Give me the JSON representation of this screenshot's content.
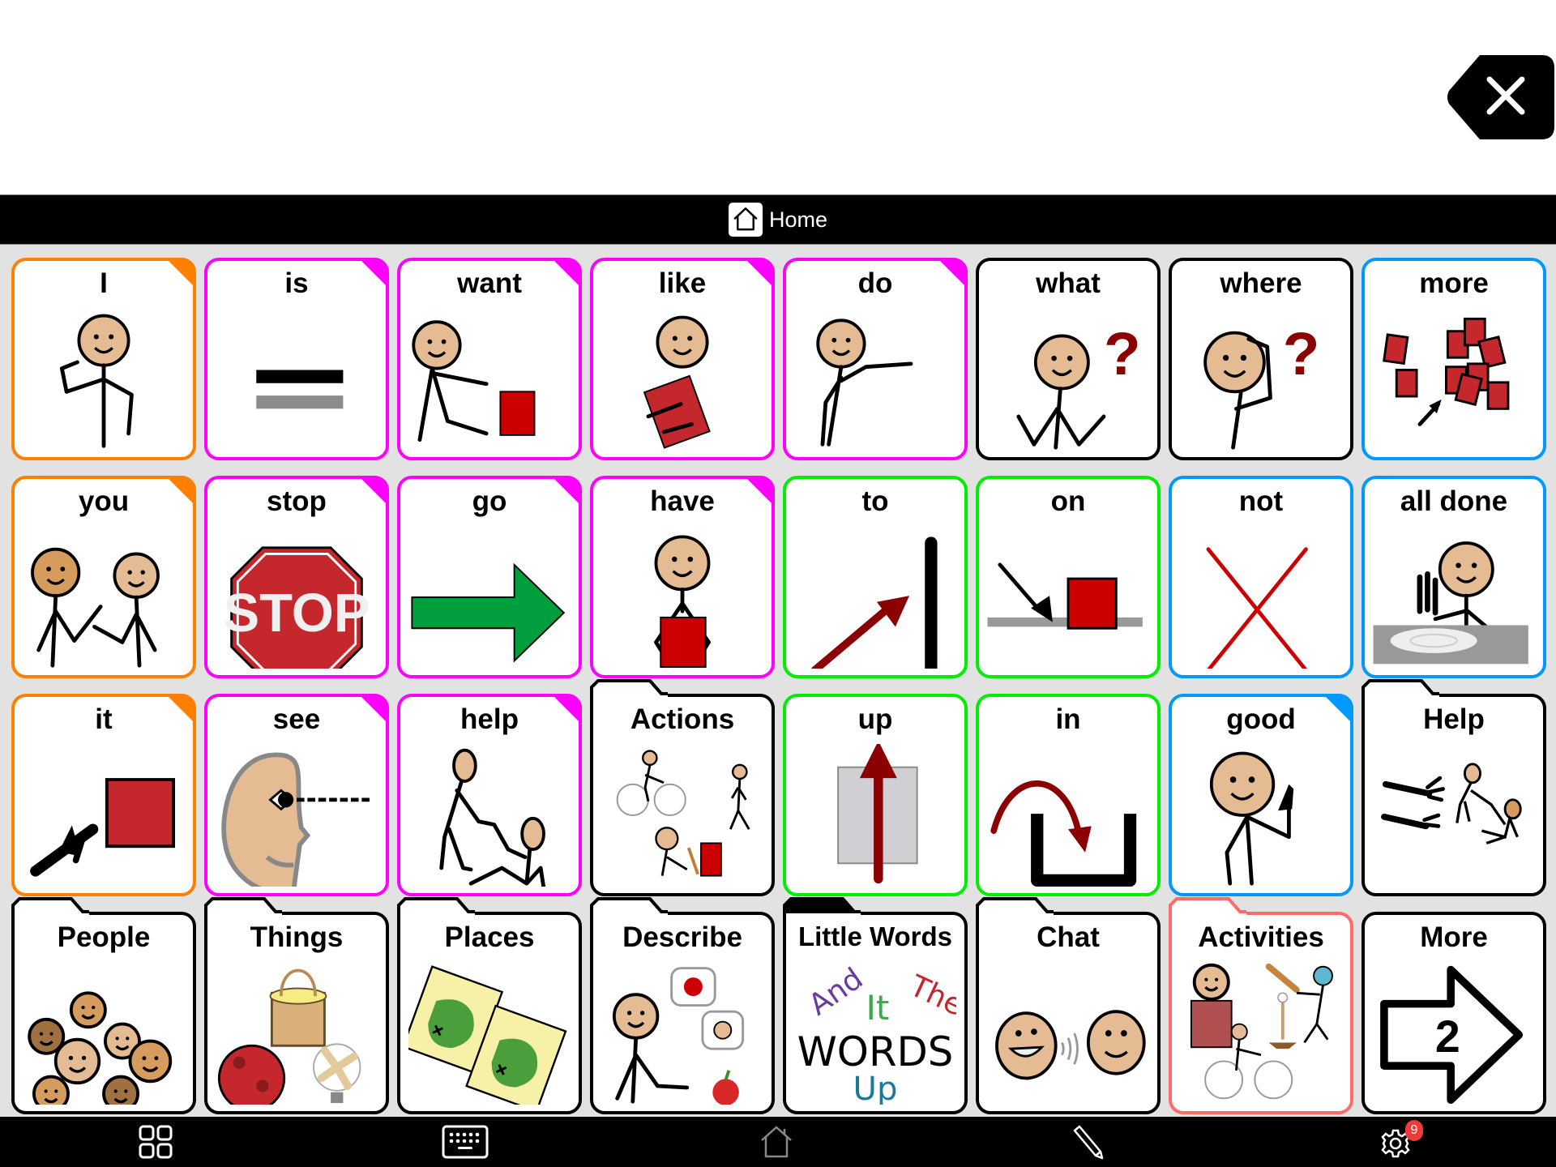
{
  "message_bar": {
    "text": "",
    "clear_button": "clear-message"
  },
  "navbar": {
    "title": "Home",
    "icon": "home-icon"
  },
  "colors": {
    "pronoun": "#ff8000",
    "verb": "#ff00ff",
    "preposition": "#00ee00",
    "adjective": "#0099ff",
    "folder": "#000000",
    "activities_folder": "#ff6b6b",
    "grid_bg": "#e2e2e2"
  },
  "cells": [
    {
      "label": "I",
      "type": "pronoun",
      "icon": "person-pointing-self"
    },
    {
      "label": "is",
      "type": "verb",
      "icon": "equals-sign"
    },
    {
      "label": "want",
      "type": "verb",
      "icon": "person-reaching-box"
    },
    {
      "label": "like",
      "type": "verb",
      "icon": "person-hugging-box"
    },
    {
      "label": "do",
      "type": "verb",
      "icon": "person-reaching"
    },
    {
      "label": "what",
      "type": "question",
      "icon": "person-shrugging-question"
    },
    {
      "label": "where",
      "type": "question",
      "icon": "person-searching-question"
    },
    {
      "label": "more",
      "type": "adjective",
      "icon": "many-red-boxes"
    },
    {
      "label": "you",
      "type": "pronoun",
      "icon": "people-pointing"
    },
    {
      "label": "stop",
      "type": "verb",
      "icon": "stop-sign"
    },
    {
      "label": "go",
      "type": "verb",
      "icon": "green-arrow-right"
    },
    {
      "label": "have",
      "type": "verb",
      "icon": "person-holding-box"
    },
    {
      "label": "to",
      "type": "preposition",
      "icon": "arrow-to-line"
    },
    {
      "label": "on",
      "type": "preposition",
      "icon": "arrow-onto-surface"
    },
    {
      "label": "not",
      "type": "adjective",
      "icon": "red-x"
    },
    {
      "label": "all done",
      "type": "adjective",
      "icon": "person-finished-plate"
    },
    {
      "label": "it",
      "type": "pronoun",
      "icon": "hand-pointing-box"
    },
    {
      "label": "see",
      "type": "verb",
      "icon": "face-eye-looking"
    },
    {
      "label": "help",
      "type": "verb",
      "icon": "person-helping-person"
    },
    {
      "label": "Actions",
      "type": "folder",
      "icon": "actions-collage"
    },
    {
      "label": "up",
      "type": "preposition",
      "icon": "arrow-up"
    },
    {
      "label": "in",
      "type": "preposition",
      "icon": "arrow-into-container"
    },
    {
      "label": "good",
      "type": "adjective",
      "icon": "person-thumbs-up"
    },
    {
      "label": "Help",
      "type": "folder",
      "icon": "help-hands"
    },
    {
      "label": "People",
      "type": "folder",
      "icon": "group-of-faces"
    },
    {
      "label": "Things",
      "type": "folder",
      "icon": "basket-ball-fan"
    },
    {
      "label": "Places",
      "type": "folder",
      "icon": "treasure-maps"
    },
    {
      "label": "Describe",
      "type": "folder",
      "icon": "person-describing"
    },
    {
      "label": "Little Words",
      "type": "folder_dark",
      "icon": "little-words",
      "words": [
        "And",
        "It",
        "The",
        "WORDS",
        "Up"
      ]
    },
    {
      "label": "Chat",
      "type": "folder",
      "icon": "two-faces-talking"
    },
    {
      "label": "Activities",
      "type": "folder_activities",
      "icon": "activities-collage"
    },
    {
      "label": "More",
      "type": "navigate",
      "icon": "arrow-page",
      "page_number": "2"
    }
  ],
  "toolbar": {
    "items": [
      {
        "name": "apps-grid",
        "icon": "grid-icon"
      },
      {
        "name": "keyboard",
        "icon": "keyboard-icon"
      },
      {
        "name": "home",
        "icon": "home-icon"
      },
      {
        "name": "edit",
        "icon": "pencil-icon"
      },
      {
        "name": "settings",
        "icon": "gear-icon",
        "badge": "9"
      }
    ]
  }
}
